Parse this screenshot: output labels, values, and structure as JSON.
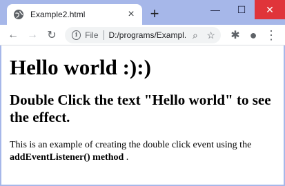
{
  "browser": {
    "tab_title": "Example2.html",
    "tab_close": "×",
    "new_tab": "+",
    "window_controls": {
      "minimize": "—",
      "maximize": "☐",
      "close": "✕"
    },
    "toolbar": {
      "back": "←",
      "forward": "→",
      "reload": "↻",
      "info": "i",
      "scheme_label": "File",
      "url": "D:/programs/Exampl...",
      "zoom_icon": "⌕",
      "star_icon": "☆",
      "extensions_icon": "✱",
      "profile_icon": "●",
      "menu_icon": "⋮"
    }
  },
  "page": {
    "heading": "Hello world :):)",
    "subheading": "Double Click the text \"Hello world\" to see the effect.",
    "paragraph_text": "This is an example of creating the double click event using the",
    "paragraph_bold": "addEventListener() method",
    "paragraph_end": " ."
  },
  "colors": {
    "frame": "#a6b7e9",
    "close_button": "#e0343a",
    "omnibox": "#f1f3f4"
  }
}
